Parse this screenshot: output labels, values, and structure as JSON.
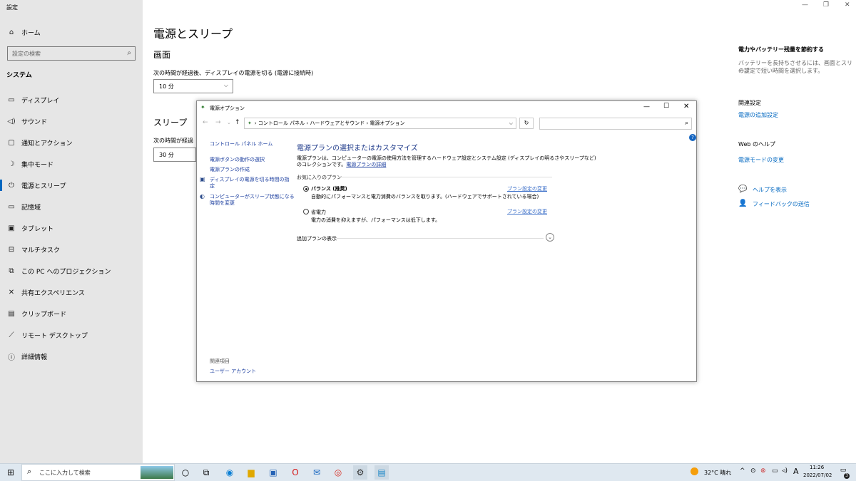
{
  "app": {
    "title": "設定"
  },
  "sidebar": {
    "home": "ホーム",
    "search_placeholder": "設定の検索",
    "section": "システム",
    "items": [
      {
        "label": "ディスプレイ",
        "icon": "monitor-icon"
      },
      {
        "label": "サウンド",
        "icon": "speaker-icon"
      },
      {
        "label": "通知とアクション",
        "icon": "notification-icon"
      },
      {
        "label": "集中モード",
        "icon": "moon-icon"
      },
      {
        "label": "電源とスリープ",
        "icon": "power-icon",
        "selected": true
      },
      {
        "label": "記憶域",
        "icon": "storage-icon"
      },
      {
        "label": "タブレット",
        "icon": "tablet-icon"
      },
      {
        "label": "マルチタスク",
        "icon": "multitask-icon"
      },
      {
        "label": "この PC へのプロジェクション",
        "icon": "projection-icon"
      },
      {
        "label": "共有エクスペリエンス",
        "icon": "share-icon"
      },
      {
        "label": "クリップボード",
        "icon": "clipboard-icon"
      },
      {
        "label": "リモート デスクトップ",
        "icon": "remote-icon"
      },
      {
        "label": "詳細情報",
        "icon": "info-icon"
      }
    ]
  },
  "main": {
    "title": "電源とスリープ",
    "screen_heading": "画面",
    "screen_label": "次の時間が経過後、ディスプレイの電源を切る (電源に接続時)",
    "screen_value": "10 分",
    "sleep_heading": "スリープ",
    "sleep_label": "次の時間が経過",
    "sleep_value": "30 分"
  },
  "right": {
    "battery_title": "電力やバッテリー残量を節約する",
    "battery_desc1": "バッテリーを長持ちさせるには、画面とスリープ",
    "battery_desc2": "の設定で短い時間を選択します。",
    "related_title": "関連設定",
    "related_link": "電源の追加設定",
    "web_help_title": "Web のヘルプ",
    "web_help_link": "電源モードの変更",
    "help_link": "ヘルプを表示",
    "feedback_link": "フィードバックの送信"
  },
  "dialog": {
    "title": "電源オプション",
    "breadcrumb": [
      "コントロール パネル",
      "ハードウェアとサウンド",
      "電源オプション"
    ],
    "sidebar_links": [
      "コントロール パネル ホーム",
      "電源ボタンの動作の選択",
      "電源プランの作成"
    ],
    "display_off_link": [
      "ディスプレイの電源を切る時間の指",
      "定"
    ],
    "sleep_link": [
      "コンピューターがスリープ状態になる",
      "時間を変更"
    ],
    "related_title": "関連項目",
    "user_account": "ユーザー アカウント",
    "heading": "電源プランの選択またはカスタマイズ",
    "desc1": "電源プランは、コンピューターの電源の使用方法を管理するハードウェア設定とシステム設定 (ディスプレイの明るさやスリープなど)",
    "desc2": "のコレクションです。",
    "desc_link": "電源プランの詳細",
    "fav_title": "お気に入りのプラン",
    "plan1_name": "バランス (推奨)",
    "plan1_desc": "自動的にパフォーマンスと電力消費のバランスを取ります。(ハードウェアでサポートされている場合)",
    "plan1_link": "プラン設定の変更",
    "plan2_name": "省電力",
    "plan2_desc": "電力の消費を抑えますが、パフォーマンスは低下します。",
    "plan2_link": "プラン設定の変更",
    "more_plans": "追加プランの表示"
  },
  "taskbar": {
    "search_placeholder": "ここに入力して検索",
    "weather": "32°C 晴れ",
    "ime": "A",
    "time": "11:26",
    "date": "2022/07/02",
    "notif_count": "3"
  }
}
